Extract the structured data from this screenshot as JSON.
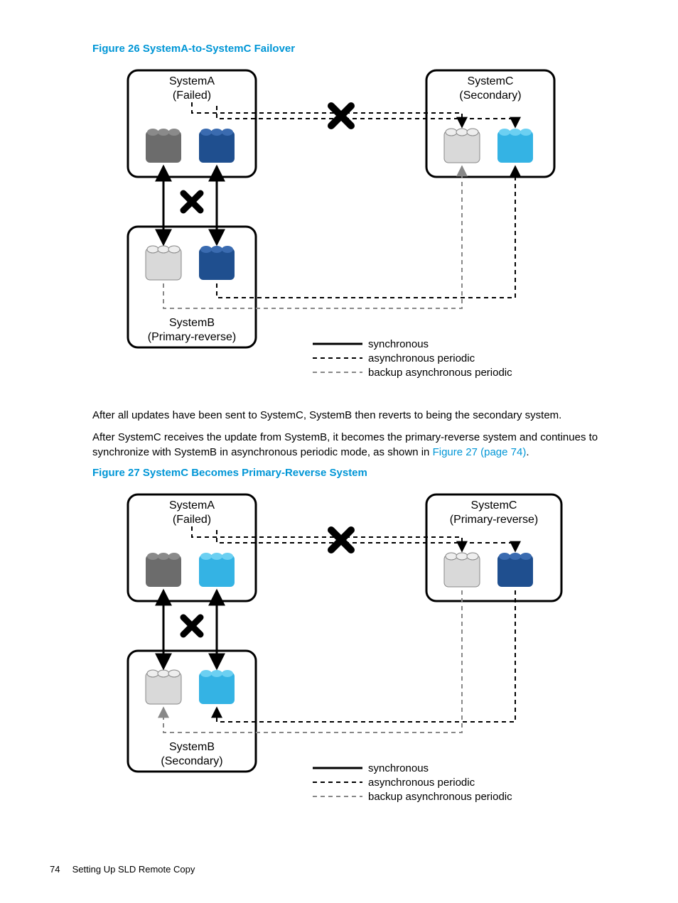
{
  "figure26": {
    "caption": "Figure 26 SystemA-to-SystemC Failover",
    "systemA": {
      "name": "SystemA",
      "state": "(Failed)"
    },
    "systemB": {
      "name": "SystemB",
      "state": "(Primary-reverse)"
    },
    "systemC": {
      "name": "SystemC",
      "state": "(Secondary)"
    },
    "legend": {
      "sync": "synchronous",
      "async": "asynchronous periodic",
      "backup": "backup asynchronous periodic"
    }
  },
  "para1": "After all updates have been sent to SystemC, SystemB then reverts to being the secondary system.",
  "para2a": "After SystemC receives the update from SystemB, it becomes the primary-reverse system and continues to synchronize with SystemB in asynchronous periodic mode, as shown in ",
  "para2link": "Figure 27 (page 74)",
  "para2b": ".",
  "figure27": {
    "caption": "Figure 27 SystemC Becomes Primary-Reverse System",
    "systemA": {
      "name": "SystemA",
      "state": "(Failed)"
    },
    "systemB": {
      "name": "SystemB",
      "state": "(Secondary)"
    },
    "systemC": {
      "name": "SystemC",
      "state": "(Primary-reverse)"
    },
    "legend": {
      "sync": "synchronous",
      "async": "asynchronous periodic",
      "backup": "backup asynchronous periodic"
    }
  },
  "footer": {
    "page": "74",
    "section": "Setting Up SLD Remote Copy"
  },
  "colors": {
    "darkgray": "#6c6c6c",
    "darkblue": "#1f4f8f",
    "lightgray": "#d9d9d9",
    "lightblue": "#34b3e4"
  }
}
